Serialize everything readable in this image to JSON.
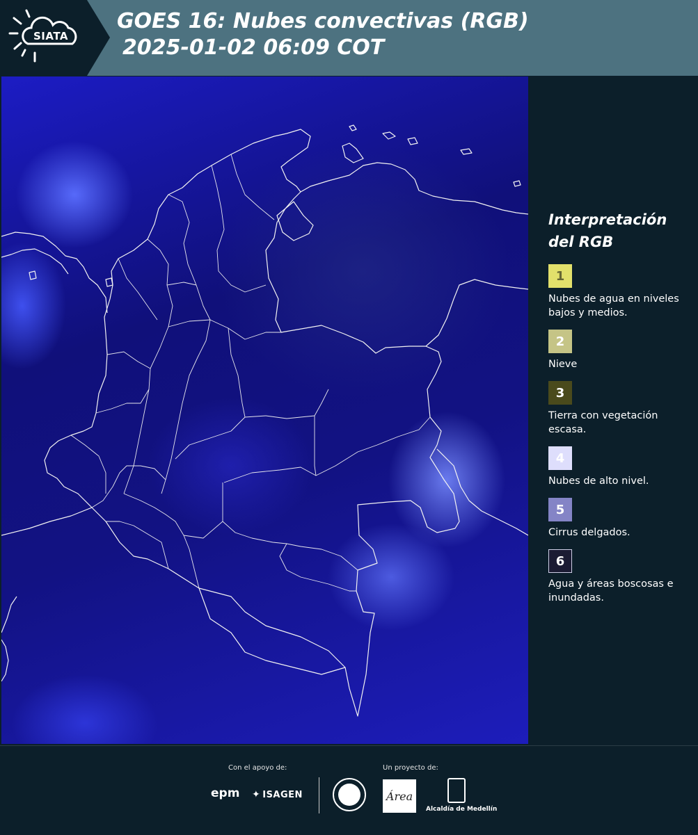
{
  "header": {
    "logo_text": "SIATA",
    "title_line1": "GOES 16: Nubes convectivas (RGB)",
    "title_line2": "2025-01-02 06:09 COT",
    "background_color": "#4d7280"
  },
  "legend": {
    "title_line1": "Interpretación",
    "title_line2": "del RGB",
    "items": [
      {
        "number": "1",
        "label": "Nubes de agua en niveles bajos y medios.",
        "color": "#e2e06b"
      },
      {
        "number": "2",
        "label": "Nieve",
        "color": "#c5c486"
      },
      {
        "number": "3",
        "label": "Tierra con vegetación escasa.",
        "color": "#4a4a1c"
      },
      {
        "number": "4",
        "label": "Nubes de alto nivel.",
        "color": "#dedefc"
      },
      {
        "number": "5",
        "label": "Cirrus delgados.",
        "color": "#8484c6"
      },
      {
        "number": "6",
        "label": "Agua y áreas boscosas e inundadas.",
        "color": "#1b1b33"
      }
    ]
  },
  "footer": {
    "support_label": "Con el apoyo de:",
    "project_label": "Un proyecto de:",
    "epm": "epm",
    "isagen": "ISAGEN",
    "area_logo": "Área",
    "alcaldia": "Alcaldía de Medellín"
  }
}
